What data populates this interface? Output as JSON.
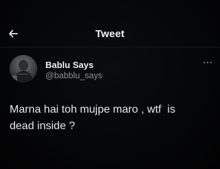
{
  "header": {
    "title": "Tweet",
    "back_icon": "arrow-left-icon"
  },
  "tweet": {
    "author": {
      "display_name": "Bablu Says",
      "handle": "@babblu_says"
    },
    "more_icon": "more-dots-icon",
    "text": "Marna hai toh mujpe maro , wtf  is\ndead inside ?"
  },
  "colors": {
    "background": "#000000",
    "text_primary": "#e7e9ea",
    "text_secondary": "#8b9196"
  }
}
